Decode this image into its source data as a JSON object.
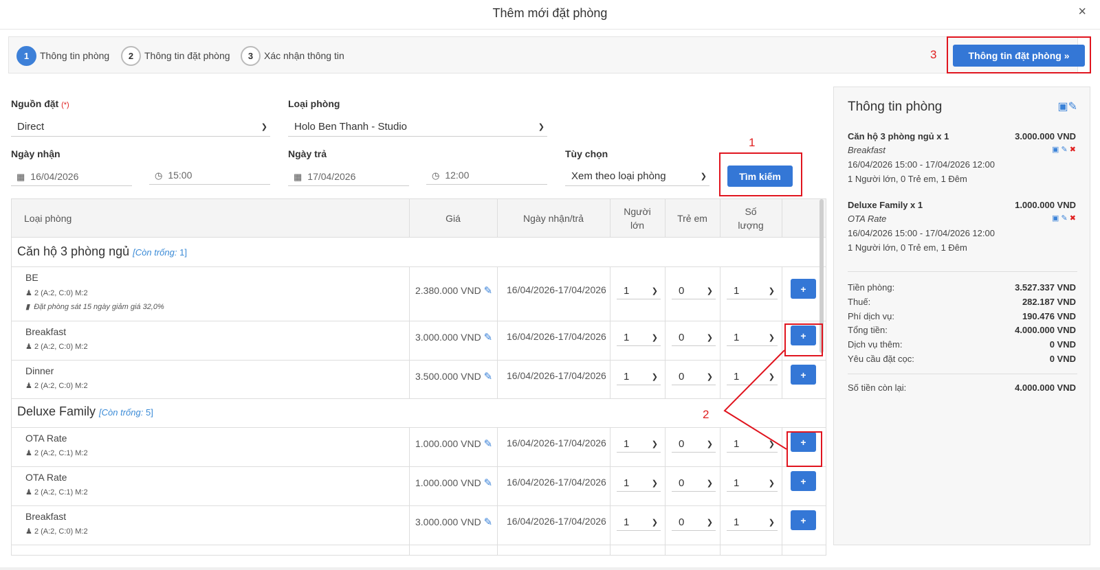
{
  "modal": {
    "title": "Thêm mới đặt phòng",
    "close": "×"
  },
  "steps": [
    {
      "num": "1",
      "label": "Thông tin phòng"
    },
    {
      "num": "2",
      "label": "Thông tin đặt phòng"
    },
    {
      "num": "3",
      "label": "Xác nhận thông tin"
    }
  ],
  "next_button": "Thông tin đặt phòng »",
  "annotations": {
    "a1": "1",
    "a2": "2",
    "a3": "3"
  },
  "form": {
    "source_label": "Nguồn đặt",
    "required_mark": "(*)",
    "source_value": "Direct",
    "room_type_label": "Loại phòng",
    "room_type_value": "Holo Ben Thanh - Studio",
    "checkin_label": "Ngày nhận",
    "checkin_date": "16/04/2026",
    "checkin_time": "15:00",
    "checkout_label": "Ngày trả",
    "checkout_date": "17/04/2026",
    "checkout_time": "12:00",
    "option_label": "Tùy chọn",
    "option_value": "Xem theo loại phòng",
    "search_button": "Tìm kiếm"
  },
  "table": {
    "headers": {
      "room_type": "Loại phòng",
      "price": "Giá",
      "dates": "Ngày nhận/trả",
      "adults_1": "Người",
      "adults_2": "lớn",
      "children": "Trẻ em",
      "qty_1": "Số",
      "qty_2": "lượng"
    },
    "groups": [
      {
        "name": "Căn hộ 3 phòng ngủ",
        "avail_label": "[Còn trống:",
        "avail_count": "1",
        "avail_close": "]"
      },
      {
        "name": "Deluxe Family",
        "avail_label": "[Còn trống:",
        "avail_count": "5",
        "avail_close": "]"
      }
    ],
    "rows": [
      {
        "name": "BE",
        "occupancy": "2 (A:2, C:0) M:2",
        "promo": "Đặt phòng sát 15 ngày giảm giá 32,0%",
        "price": "2.380.000 VND",
        "dates": "16/04/2026-17/04/2026",
        "adults": "1",
        "children": "0",
        "qty": "1",
        "add": "+"
      },
      {
        "name": "Breakfast",
        "occupancy": "2 (A:2, C:0) M:2",
        "price": "3.000.000 VND",
        "dates": "16/04/2026-17/04/2026",
        "adults": "1",
        "children": "0",
        "qty": "1",
        "add": "+"
      },
      {
        "name": "Dinner",
        "occupancy": "2 (A:2, C:0) M:2",
        "price": "3.500.000 VND",
        "dates": "16/04/2026-17/04/2026",
        "adults": "1",
        "children": "0",
        "qty": "1",
        "add": "+"
      },
      {
        "name": "OTA Rate",
        "occupancy": "2 (A:2, C:1) M:2",
        "price": "1.000.000 VND",
        "dates": "16/04/2026-17/04/2026",
        "adults": "1",
        "children": "0",
        "qty": "1",
        "add": "+"
      },
      {
        "name": "OTA Rate",
        "occupancy": "2 (A:2, C:1) M:2",
        "price": "1.000.000 VND",
        "dates": "16/04/2026-17/04/2026",
        "adults": "1",
        "children": "0",
        "qty": "1",
        "add": "+"
      },
      {
        "name": "Breakfast",
        "occupancy": "2 (A:2, C:0) M:2",
        "price": "3.000.000 VND",
        "dates": "16/04/2026-17/04/2026",
        "adults": "1",
        "children": "0",
        "qty": "1",
        "add": "+"
      }
    ]
  },
  "sidebar": {
    "title": "Thông tin phòng",
    "items": [
      {
        "name": "Căn hộ 3 phòng ngủ x 1",
        "amount": "3.000.000 VND",
        "rate": "Breakfast",
        "period": "16/04/2026 15:00 - 17/04/2026 12:00",
        "guests": "1 Người lớn, 0 Trẻ em, 1 Đêm"
      },
      {
        "name": "Deluxe Family x 1",
        "amount": "1.000.000 VND",
        "rate": "OTA Rate",
        "period": "16/04/2026 15:00 - 17/04/2026 12:00",
        "guests": "1 Người lớn, 0 Trẻ em, 1 Đêm"
      }
    ],
    "totals": [
      {
        "label": "Tiền phòng:",
        "value": "3.527.337 VND"
      },
      {
        "label": "Thuế:",
        "value": "282.187 VND"
      },
      {
        "label": "Phí dịch vụ:",
        "value": "190.476 VND"
      },
      {
        "label": "Tổng tiền:",
        "value": "4.000.000 VND"
      },
      {
        "label": "Dịch vụ thêm:",
        "value": "0 VND"
      },
      {
        "label": "Yêu cầu đặt cọc:",
        "value": "0 VND"
      }
    ],
    "remaining": {
      "label": "Số tiền còn lại:",
      "value": "4.000.000 VND"
    }
  }
}
